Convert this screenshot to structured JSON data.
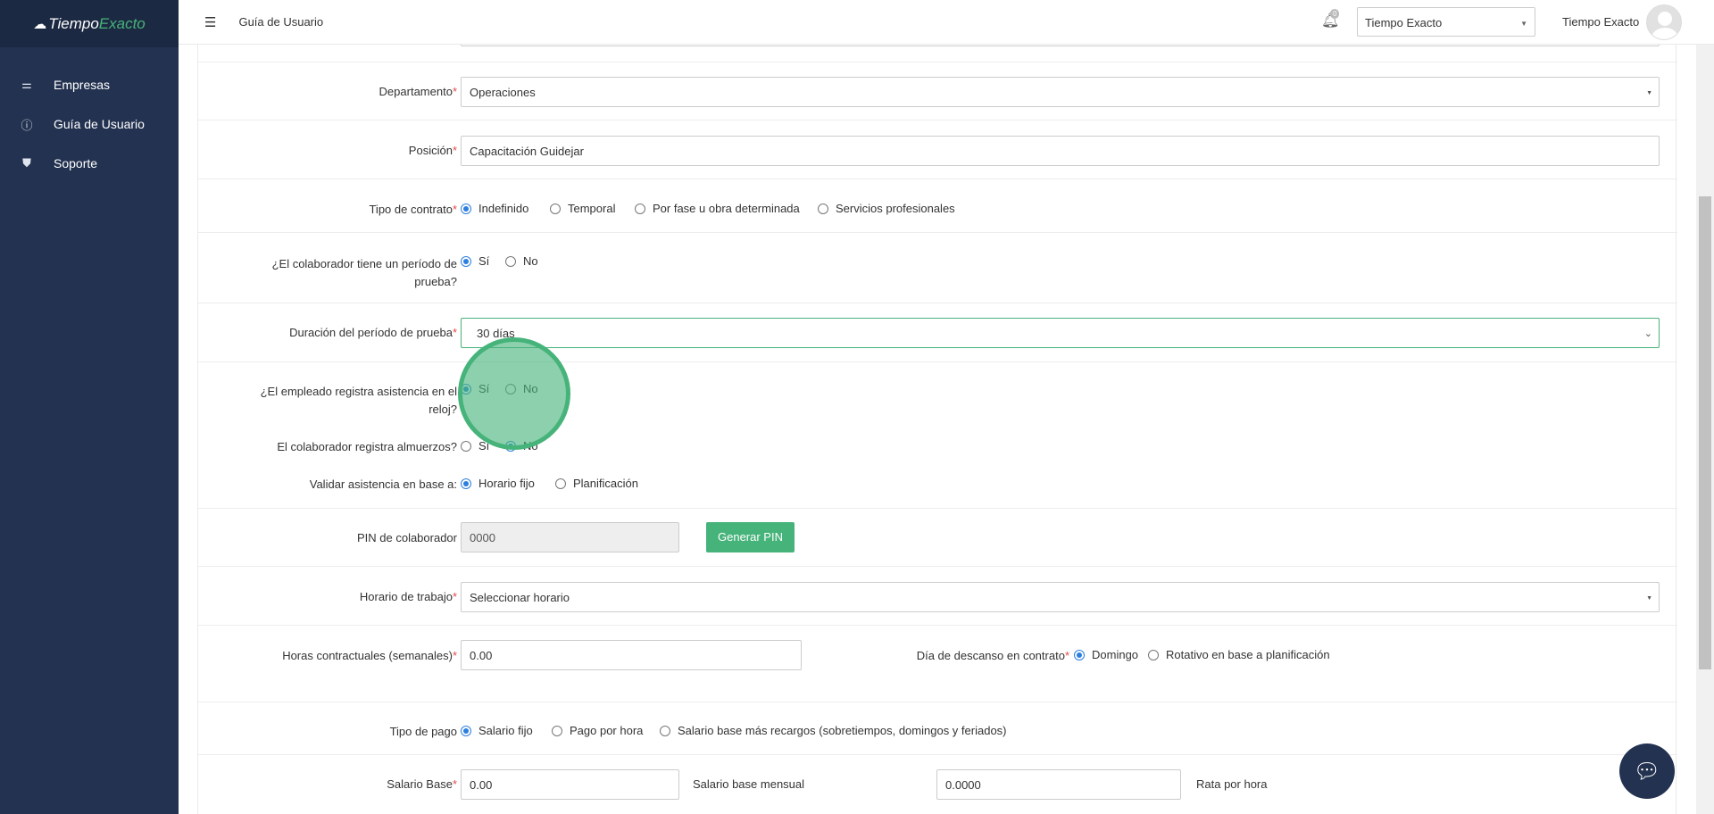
{
  "sidebar": {
    "logo_main": "Tiempo",
    "logo_accent": "Exacto",
    "items": [
      {
        "label": "Empresas"
      },
      {
        "label": "Guía de Usuario"
      },
      {
        "label": "Soporte"
      }
    ]
  },
  "header": {
    "title": "Guía de Usuario",
    "notifications_count": "0",
    "company_selected": "Tiempo Exacto",
    "user_name": "Tiempo Exacto"
  },
  "form": {
    "departamento": {
      "label": "Departamento",
      "value": "Operaciones"
    },
    "posicion": {
      "label": "Posición",
      "value": "Capacitación Guidejar"
    },
    "tipo_contrato": {
      "label": "Tipo de contrato",
      "options": [
        "Indefinido",
        "Temporal",
        "Por fase u obra determinada",
        "Servicios profesionales"
      ],
      "selected": "Indefinido"
    },
    "periodo_prueba": {
      "label_line1": "¿El colaborador tiene un período de",
      "label_line2": "prueba?",
      "options": [
        "Sí",
        "No"
      ],
      "selected": "Sí"
    },
    "duracion_prueba": {
      "label": "Duración del período de prueba",
      "value": "30 días"
    },
    "registra_reloj": {
      "label_line1": "¿El empleado registra asistencia en el",
      "label_line2": "reloj?",
      "options": [
        "Sí",
        "No"
      ],
      "selected": "Sí"
    },
    "registra_almuerzos": {
      "label": "El colaborador registra almuerzos?",
      "options": [
        "Sí",
        "No"
      ],
      "selected": "No"
    },
    "validar_asistencia": {
      "label": "Validar asistencia en base a:",
      "options": [
        "Horario fijo",
        "Planificación"
      ],
      "selected": "Horario fijo"
    },
    "pin": {
      "label": "PIN de colaborador",
      "value": "0000",
      "button": "Generar PIN"
    },
    "horario": {
      "label": "Horario de trabajo",
      "value": "Seleccionar horario"
    },
    "horas": {
      "label": "Horas contractuales (semanales)",
      "value": "0.00"
    },
    "descanso": {
      "label": "Día de descanso en contrato",
      "options": [
        "Domingo",
        "Rotativo en base a planificación"
      ],
      "selected": "Domingo"
    },
    "tipo_pago": {
      "label": "Tipo de pago",
      "options": [
        "Salario fijo",
        "Pago por hora",
        "Salario base más recargos (sobretiempos, domingos y feriados)"
      ],
      "selected": "Salario fijo"
    },
    "salario": {
      "label": "Salario Base",
      "value": "0.00",
      "helper": "Salario base mensual",
      "rate_value": "0.0000",
      "rate_helper": "Rata por hora"
    },
    "required_mark": "*"
  },
  "colors": {
    "sidebar": "#233250",
    "accent": "#46b37a",
    "radio": "#2d7fdd"
  }
}
